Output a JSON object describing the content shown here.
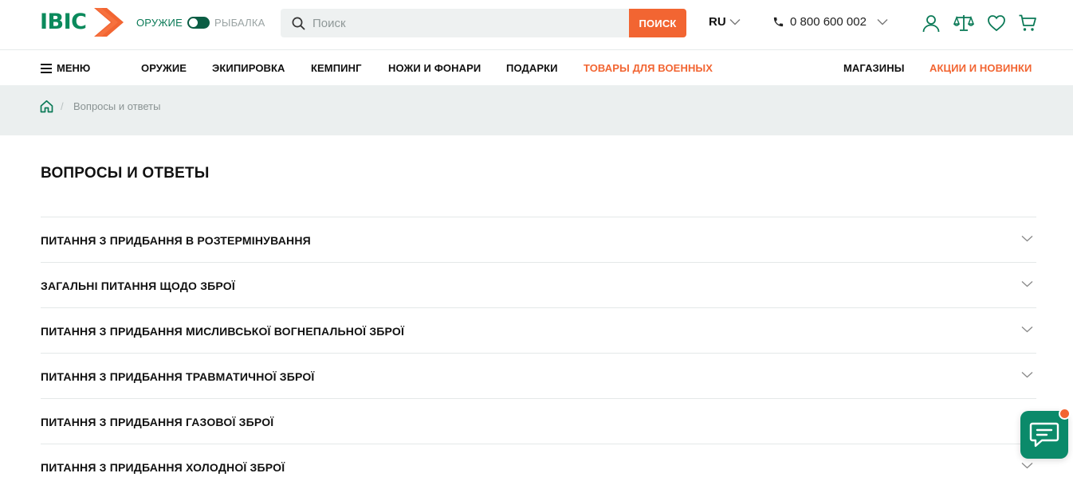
{
  "colors": {
    "brand_green": "#0b8a5c",
    "accent_orange": "#f26532",
    "breadcrumb_bg": "#ebefef"
  },
  "header": {
    "logo_text": "ІВІС",
    "toggle": {
      "left_label": "ОРУЖИЕ",
      "right_label": "РЫБАЛКА",
      "state": "left"
    },
    "search": {
      "placeholder": "Поиск",
      "value": "",
      "button_label": "ПОИСК"
    },
    "language": "RU",
    "phone": "0 800 600 002",
    "icons": [
      "user-icon",
      "scales-compare-icon",
      "heart-icon",
      "cart-icon"
    ]
  },
  "nav": {
    "menu_label": "МЕНЮ",
    "items": [
      {
        "label": "ОРУЖИЕ",
        "accent": false
      },
      {
        "label": "ЭКИПИРОВКА",
        "accent": false
      },
      {
        "label": "КЕМПИНГ",
        "accent": false
      },
      {
        "label": "НОЖИ И ФОНАРИ",
        "accent": false
      },
      {
        "label": "ПОДАРКИ",
        "accent": false
      },
      {
        "label": "ТОВАРЫ ДЛЯ ВОЕННЫХ",
        "accent": true
      }
    ],
    "right_items": [
      {
        "label": "МАГАЗИНЫ",
        "accent": false
      },
      {
        "label": "АКЦИИ И НОВИНКИ",
        "accent": true
      }
    ]
  },
  "breadcrumb": {
    "separator": "/",
    "current": "Вопросы и ответы"
  },
  "page": {
    "title": "ВОПРОСЫ И ОТВЕТЫ",
    "faq": [
      "ПИТАННЯ З ПРИДБАННЯ В РОЗТЕРМІНУВАННЯ",
      "ЗАГАЛЬНІ ПИТАННЯ ЩОДО ЗБРОЇ",
      "ПИТАННЯ З ПРИДБАННЯ МИСЛИВСЬКОЇ ВОГНЕПАЛЬНОЇ ЗБРОЇ",
      "ПИТАННЯ З ПРИДБАННЯ ТРАВМАТИЧНОЇ ЗБРОЇ",
      "ПИТАННЯ З ПРИДБАННЯ ГАЗОВОЇ ЗБРОЇ",
      "ПИТАННЯ З ПРИДБАННЯ ХОЛОДНОЇ ЗБРОЇ"
    ]
  }
}
